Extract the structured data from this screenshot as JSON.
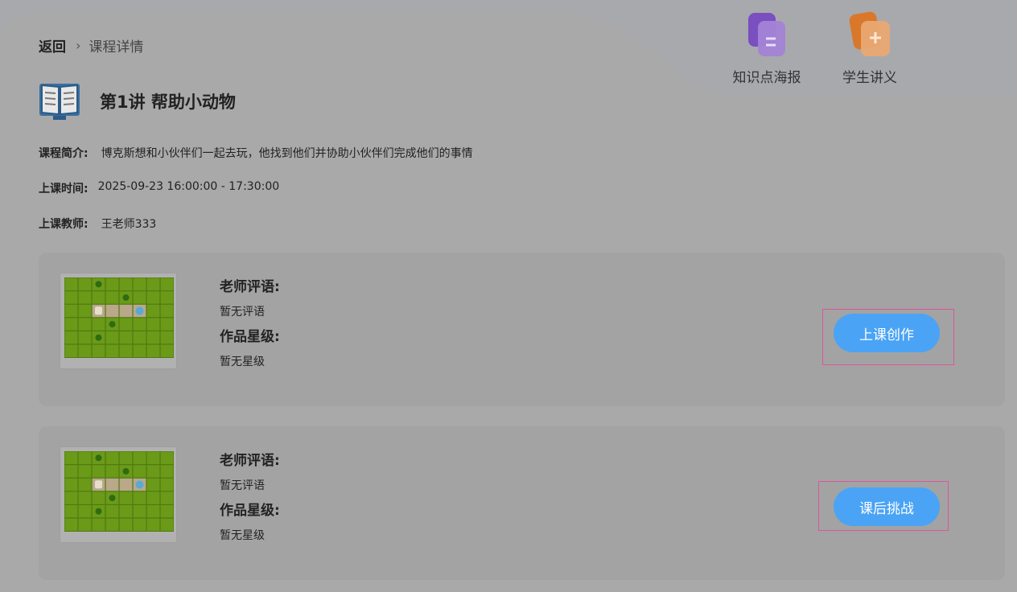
{
  "breadcrumb": {
    "back_label": "返回",
    "separator": "›",
    "current": "课程详情"
  },
  "lesson": {
    "title": "第1讲 帮助小动物",
    "icon": "book-icon"
  },
  "info": {
    "intro_label": "课程简介:",
    "intro_value": "博克斯想和小伙伴们一起去玩，他找到他们并协助小伙伴们完成他们的事情",
    "time_label": "上课时间:",
    "time_value": "2025-09-23 16:00:00 - 17:30:00",
    "teacher_label": "上课教师:",
    "teacher_value": "王老师333"
  },
  "tools": [
    {
      "label": "知识点海报",
      "icon": "poster-document-icon",
      "color": "#8a62c9"
    },
    {
      "label": "学生讲义",
      "icon": "handout-document-icon",
      "color": "#e08a3c"
    }
  ],
  "cards": [
    {
      "comment_label": "老师评语:",
      "comment_value": "暂无评语",
      "rating_label": "作品星级:",
      "rating_value": "暂无星级",
      "button_label": "上课创作"
    },
    {
      "comment_label": "老师评语:",
      "comment_value": "暂无评语",
      "rating_label": "作品星级:",
      "rating_value": "暂无星级",
      "button_label": "课后挑战"
    }
  ],
  "colors": {
    "accent": "#4aa3f5",
    "highlight_border": "#e0559a",
    "grass": "#6a9a18"
  }
}
